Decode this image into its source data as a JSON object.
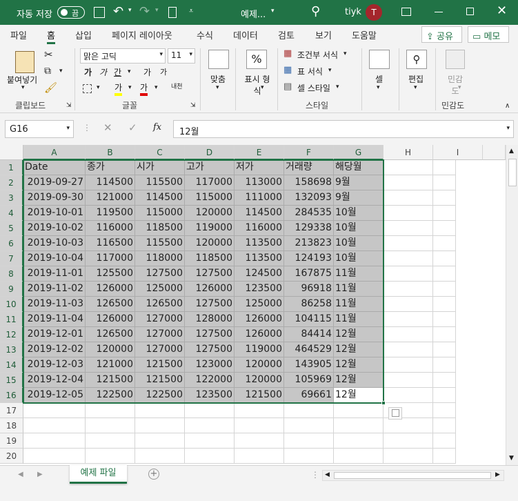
{
  "titlebar": {
    "autosave_label": "자동 저장",
    "autosave_state": "끔",
    "filename": "예제...",
    "user_name": "tiyk",
    "avatar_initial": "T"
  },
  "tabs": [
    "파일",
    "홈",
    "삽입",
    "페이지 레이아웃",
    "수식",
    "데이터",
    "검토",
    "보기",
    "도움말"
  ],
  "share_label": "공유",
  "memo_label": "메모",
  "ribbon": {
    "paste_label": "붙여넣기",
    "font_name": "맑은 고딕",
    "font_size": "11",
    "bold": "가",
    "italic": "가",
    "underline": "간",
    "grow_font": "가",
    "shrink_font": "가",
    "phonetic": "내천",
    "highlight": "가",
    "font_color": "가",
    "align_label": "맞춤",
    "number_format_label": "표시 형식",
    "number_symbol": "%",
    "cond_format_label": "조건부 서식",
    "table_format_label": "표 서식",
    "cell_style_label": "셀 스타일",
    "cells_label": "셀",
    "editing_label": "편집",
    "sensitivity_label": "민감도",
    "groups": {
      "clipboard": "클립보드",
      "font": "글꼴",
      "style": "스타일",
      "sensitivity": "민감도"
    }
  },
  "formula_bar": {
    "name_box": "G16",
    "fx": "fx",
    "content": "12월"
  },
  "columns": [
    "A",
    "B",
    "C",
    "D",
    "E",
    "F",
    "G",
    "H",
    "I"
  ],
  "rows": [
    [
      "Date",
      "종가",
      "시가",
      "고가",
      "저가",
      "거래량",
      "해당월"
    ],
    [
      "2019-09-27",
      "114500",
      "115500",
      "117000",
      "113000",
      "158698",
      "9월"
    ],
    [
      "2019-09-30",
      "121000",
      "114500",
      "115000",
      "111000",
      "132093",
      "9월"
    ],
    [
      "2019-10-01",
      "119500",
      "115000",
      "120000",
      "114500",
      "284535",
      "10월"
    ],
    [
      "2019-10-02",
      "116000",
      "118500",
      "119000",
      "116000",
      "129338",
      "10월"
    ],
    [
      "2019-10-03",
      "116500",
      "115500",
      "120000",
      "113500",
      "213823",
      "10월"
    ],
    [
      "2019-10-04",
      "117000",
      "118000",
      "118500",
      "113500",
      "124193",
      "10월"
    ],
    [
      "2019-11-01",
      "125500",
      "127500",
      "127500",
      "124500",
      "167875",
      "11월"
    ],
    [
      "2019-11-02",
      "126000",
      "125000",
      "126000",
      "123500",
      "96918",
      "11월"
    ],
    [
      "2019-11-03",
      "126500",
      "126500",
      "127500",
      "125000",
      "86258",
      "11월"
    ],
    [
      "2019-11-04",
      "126000",
      "127000",
      "128000",
      "126000",
      "104115",
      "11월"
    ],
    [
      "2019-12-01",
      "126500",
      "127000",
      "127500",
      "126000",
      "84414",
      "12월"
    ],
    [
      "2019-12-02",
      "120000",
      "127000",
      "127500",
      "119000",
      "464529",
      "12월"
    ],
    [
      "2019-12-03",
      "121000",
      "121500",
      "123000",
      "120000",
      "143905",
      "12월"
    ],
    [
      "2019-12-04",
      "121500",
      "121500",
      "122000",
      "120000",
      "105969",
      "12월"
    ],
    [
      "2019-12-05",
      "122500",
      "122500",
      "123500",
      "121500",
      "69661",
      "12월"
    ]
  ],
  "sheet_tab": "예제 파일",
  "colors": {
    "accent": "#217346",
    "selection": "#c6c6c6",
    "header_bg": "#f3f3f3",
    "gridline": "#d4d4d4"
  }
}
